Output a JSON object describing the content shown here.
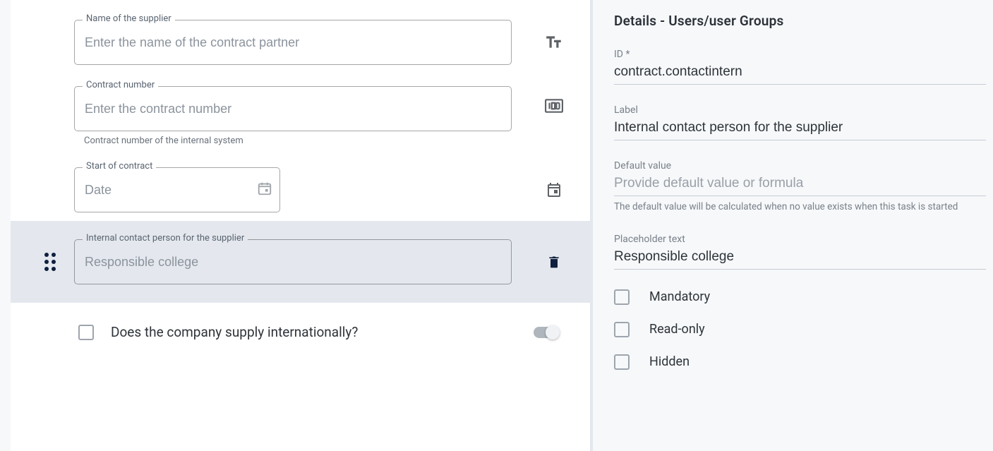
{
  "form": {
    "fields": [
      {
        "legend": "Name of the supplier",
        "placeholder": "Enter the name of the contract partner",
        "value": ""
      },
      {
        "legend": "Contract number",
        "placeholder": "Enter the contract number",
        "value": "",
        "helper": "Contract number of the internal system"
      },
      {
        "legend": "Start of contract",
        "placeholder": "Date",
        "value": ""
      },
      {
        "legend": "Internal contact person for the supplier",
        "placeholder": "Responsible college",
        "value": ""
      }
    ],
    "checkbox_question": "Does the company supply internationally?"
  },
  "details": {
    "title": "Details - Users/user Groups",
    "id_label": "ID *",
    "id_value": "contract.contactintern",
    "label_label": "Label",
    "label_value": "Internal contact person for the supplier",
    "default_label": "Default value",
    "default_placeholder": "Provide default value or formula",
    "default_value": "",
    "default_helper": "The default value will be calculated when no value exists when this task is started",
    "ph_label": "Placeholder text",
    "ph_value": "Responsible college",
    "options": {
      "mandatory": "Mandatory",
      "readonly": "Read-only",
      "hidden": "Hidden"
    }
  }
}
